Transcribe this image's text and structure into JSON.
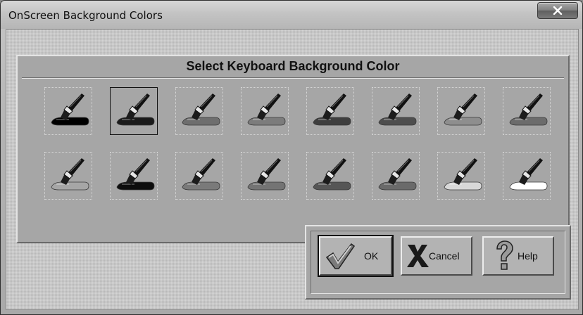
{
  "window": {
    "title": "OnScreen Background Colors",
    "close_icon": "close-icon"
  },
  "panel": {
    "heading": "Select Keyboard Background Color",
    "selected_index": 1,
    "brush_icon": "paintbrush-icon",
    "colors": [
      "#000000",
      "#1a1a1a",
      "#6e6e6e",
      "#7c7c7c",
      "#3e3e3e",
      "#4e4e4e",
      "#8e8e8e",
      "#6c6c6c",
      "#a6a6a6",
      "#0d0d0d",
      "#7a7a7a",
      "#747474",
      "#565656",
      "#6a6a6a",
      "#d8d8d8",
      "#ffffff"
    ]
  },
  "buttons": {
    "ok": {
      "label": "OK",
      "icon": "checkmark-icon"
    },
    "cancel": {
      "label": "Cancel",
      "icon": "x-mark-icon"
    },
    "help": {
      "label": "Help",
      "icon": "question-mark-icon"
    }
  }
}
